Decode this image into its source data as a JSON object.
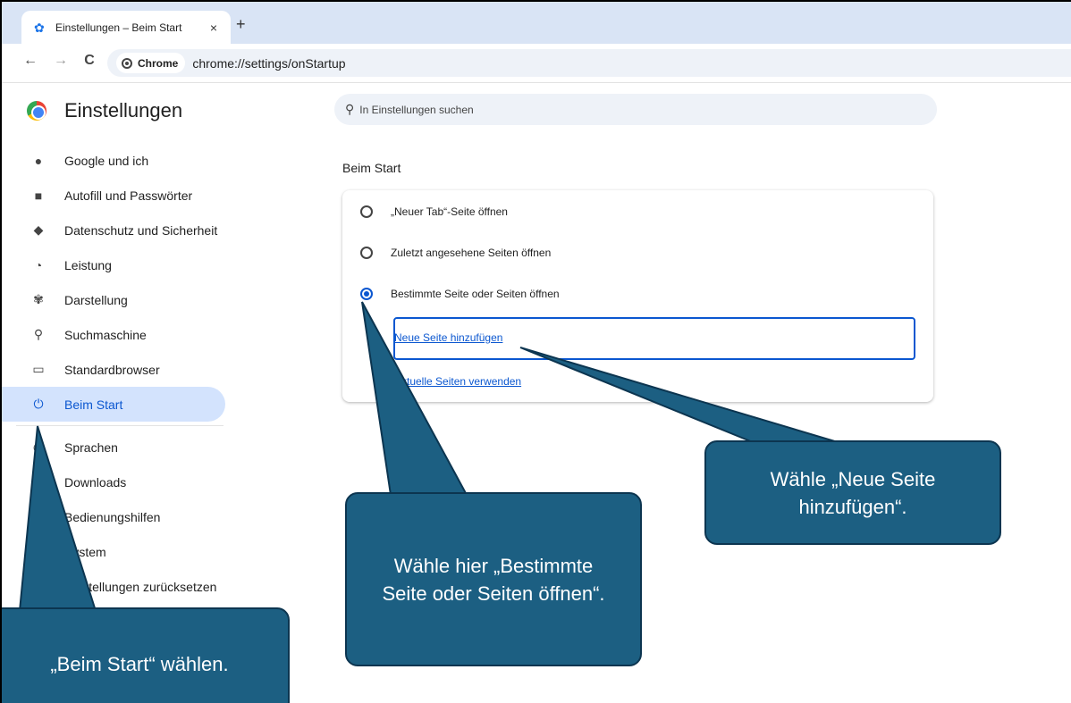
{
  "browser": {
    "tab_title": "Einstellungen – Beim Start",
    "tab_close": "×",
    "new_tab": "+",
    "back": "←",
    "forward": "→",
    "reload": "C",
    "chip_label": "Chrome",
    "url": "chrome://settings/onStartup"
  },
  "sidebar": {
    "title": "Einstellungen",
    "items": [
      {
        "label": "Google und ich",
        "icon": "person-icon"
      },
      {
        "label": "Autofill und Passwörter",
        "icon": "clipboard-icon"
      },
      {
        "label": "Datenschutz und Sicherheit",
        "icon": "shield-icon"
      },
      {
        "label": "Leistung",
        "icon": "speedometer-icon"
      },
      {
        "label": "Darstellung",
        "icon": "palette-icon"
      },
      {
        "label": "Suchmaschine",
        "icon": "search-icon"
      },
      {
        "label": "Standardbrowser",
        "icon": "browser-icon"
      },
      {
        "label": "Beim Start",
        "icon": "power-icon",
        "active": true
      },
      {
        "label": "Sprachen",
        "icon": "globe-icon"
      },
      {
        "label": "Downloads",
        "icon": "download-icon"
      },
      {
        "label": "Bedienungshilfen",
        "icon": "accessibility-icon"
      },
      {
        "label": "System",
        "icon": "wrench-icon"
      },
      {
        "label": "Einstellungen zurücksetzen",
        "icon": "reset-icon"
      }
    ]
  },
  "search": {
    "placeholder": "In Einstellungen suchen"
  },
  "main": {
    "section_title": "Beim Start",
    "options": [
      {
        "label": "„Neuer Tab“-Seite öffnen",
        "checked": false
      },
      {
        "label": "Zuletzt angesehene Seiten öffnen",
        "checked": false
      },
      {
        "label": "Bestimmte Seite oder Seiten öffnen",
        "checked": true
      }
    ],
    "add_page_link": "Neue Seite hinzufügen",
    "use_current_link": "Aktuelle Seiten verwenden"
  },
  "callouts": {
    "beim_start": "„Beim Start“ wählen.",
    "bestimmte": "Wähle hier „Bestimmte Seite oder Seiten öffnen“.",
    "neue_seite": "Wähle „Neue Seite hinzufügen“."
  },
  "colors": {
    "accent": "#0b57d0",
    "active_bg": "#d3e3fd",
    "callout": "#1c5f82",
    "tabstrip": "#d9e4f5"
  }
}
